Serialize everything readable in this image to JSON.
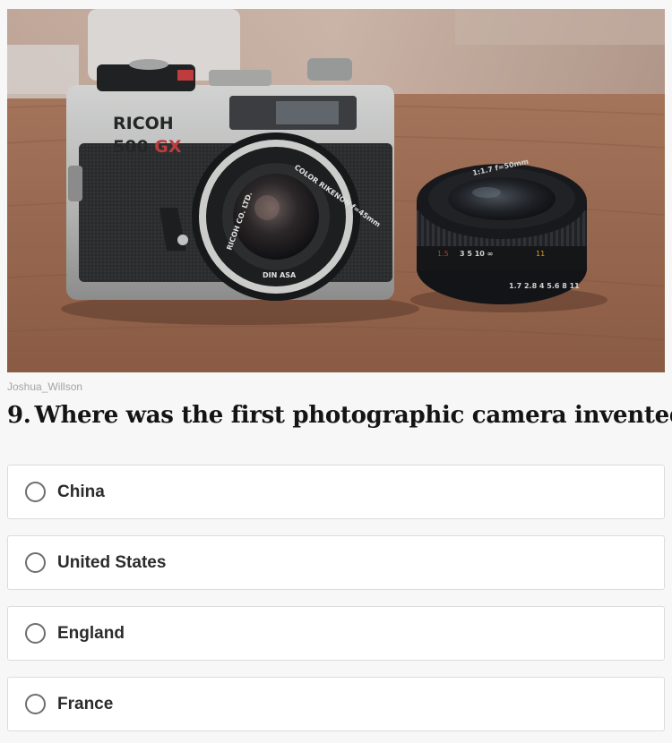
{
  "photo": {
    "alt": "Ricoh 500 GX camera and lens on a wooden table",
    "camera_brand": "RICOH",
    "camera_model_number": "500",
    "camera_model_suffix": "GX",
    "credit": "Joshua_Willson"
  },
  "question": {
    "number": "9.",
    "text": "Where was the first photographic camera invented?"
  },
  "answers": [
    {
      "label": "China",
      "selected": false
    },
    {
      "label": "United States",
      "selected": false
    },
    {
      "label": "England",
      "selected": false
    },
    {
      "label": "France",
      "selected": false
    }
  ],
  "colors": {
    "background": "#f7f7f7",
    "card": "#ffffff",
    "card_border": "#dcdcdc",
    "radio_border": "#6e6e6e",
    "question_text": "#141414",
    "answer_text": "#2b2b2b",
    "credit_text": "#a4a4a4",
    "gx_accent": "#c33a3a"
  }
}
